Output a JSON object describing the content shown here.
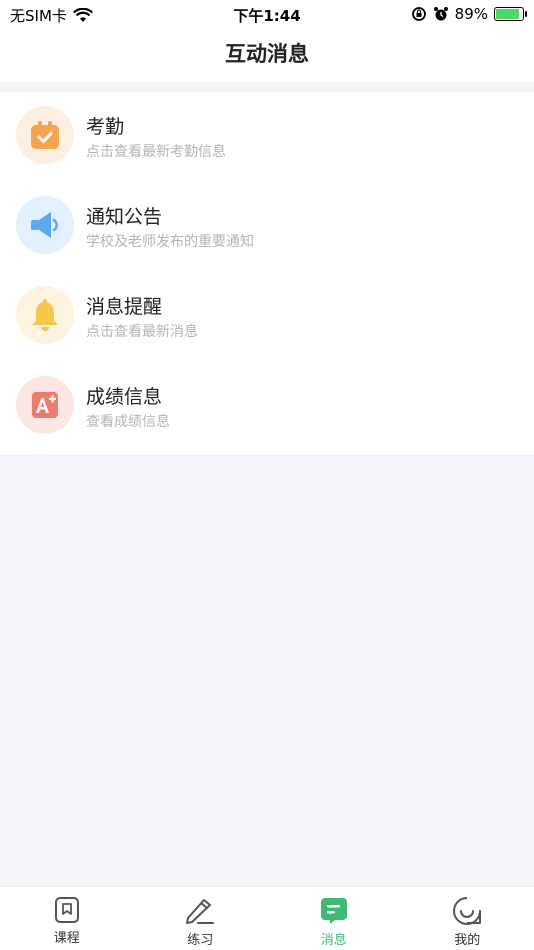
{
  "status_bar": {
    "carrier": "无SIM卡",
    "time": "下午1:44",
    "battery": "89%"
  },
  "header": {
    "title": "互动消息"
  },
  "items": [
    {
      "title": "考勤",
      "subtitle": "点击查看最新考勤信息",
      "icon": "calendar-icon",
      "color": "#f5a54d",
      "bg": "#fdefe2"
    },
    {
      "title": "通知公告",
      "subtitle": "学校及老师发布的重要通知",
      "icon": "megaphone-icon",
      "color": "#5aa8ef",
      "bg": "#e3f0fd"
    },
    {
      "title": "消息提醒",
      "subtitle": "点击查看最新消息",
      "icon": "bell-icon",
      "color": "#f6c64d",
      "bg": "#fdf3de"
    },
    {
      "title": "成绩信息",
      "subtitle": "查看成绩信息",
      "icon": "grade-a-plus-icon",
      "color": "#ee7c6c",
      "bg": "#fce7e4"
    }
  ],
  "tabs": [
    {
      "label": "课程",
      "icon": "bookmark-icon",
      "active": false
    },
    {
      "label": "练习",
      "icon": "pencil-icon",
      "active": false
    },
    {
      "label": "消息",
      "icon": "message-icon",
      "active": true
    },
    {
      "label": "我的",
      "icon": "smile-icon",
      "active": false
    }
  ],
  "colors": {
    "accent": "#3dbb73",
    "page_bg": "#f4f5f9"
  }
}
